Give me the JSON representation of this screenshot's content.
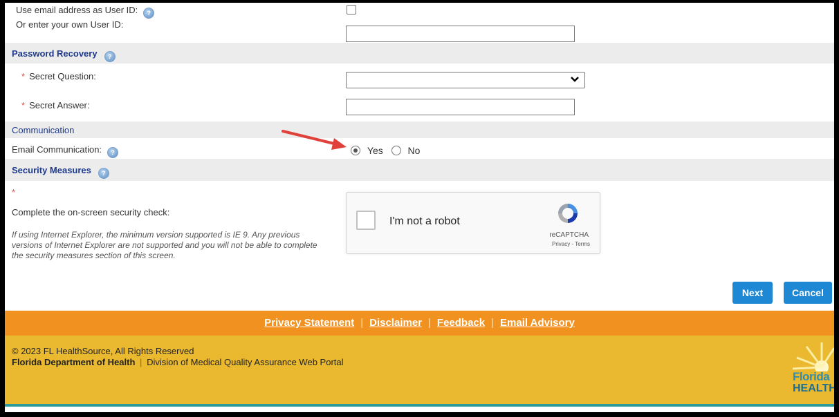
{
  "user_id": {
    "use_email_label": "Use email address as User ID:",
    "own_id_label": "Or enter your own User ID:",
    "own_id_value": ""
  },
  "password_recovery": {
    "title": "Password Recovery",
    "secret_question_label": "Secret Question:",
    "secret_question_value": "",
    "secret_answer_label": "Secret Answer:",
    "secret_answer_value": ""
  },
  "communication": {
    "title": "Communication",
    "email_label": "Email Communication:",
    "yes_label": "Yes",
    "no_label": "No",
    "selected": "Yes"
  },
  "security": {
    "title": "Security Measures",
    "required_mark": "*",
    "check_label": "Complete the on-screen security check:",
    "ie_note": "If using Internet Explorer, the minimum version supported is IE 9. Any previous versions of Internet Explorer are not supported and you will not be able to complete the security measures section of this screen.",
    "captcha_text": "I'm not a robot",
    "captcha_brand": "reCAPTCHA",
    "captcha_terms": "Privacy - Terms"
  },
  "buttons": {
    "next": "Next",
    "cancel": "Cancel"
  },
  "footer_links": {
    "privacy": "Privacy Statement",
    "disclaimer": "Disclaimer",
    "feedback": "Feedback",
    "email_advisory": "Email Advisory",
    "separator": "|"
  },
  "footer": {
    "copyright": "© 2023 FL HealthSource, All Rights Reserved",
    "dept": "Florida Department of Health",
    "separator": "|",
    "division": "Division of Medical Quality Assurance Web Portal",
    "logo_line1": "Florida",
    "logo_line2": "HEALTH"
  },
  "colors": {
    "accent_blue": "#1e88d4",
    "orange_bar": "#f1911f",
    "yellow_bar": "#eab92f",
    "section_text": "#1f3a8a",
    "required": "#d9534f"
  },
  "icons": [
    "help-icon",
    "recaptcha-logo-icon",
    "annotation-arrow",
    "chevron-down-icon"
  ]
}
